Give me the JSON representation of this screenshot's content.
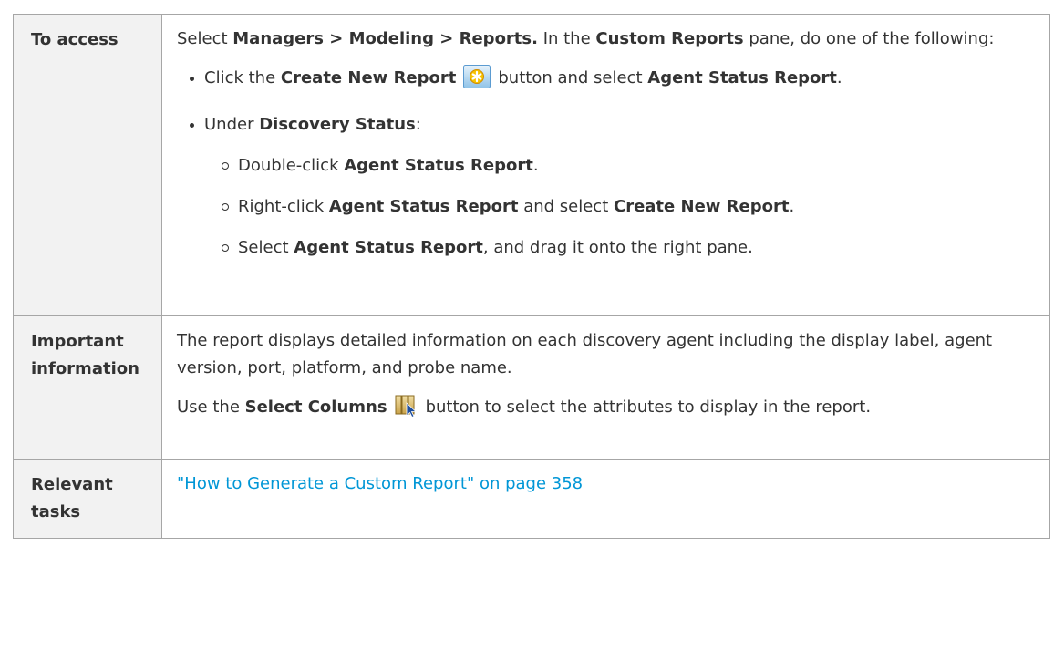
{
  "access": {
    "label": "To access",
    "intro": {
      "t1": "Select ",
      "b1": "Managers > Modeling > Reports.",
      "t2": " In the ",
      "b2": "Custom Reports",
      "t3": " pane, do one of the following:"
    },
    "bullet1": {
      "t1": "Click the ",
      "b1": "Create New Report",
      "icon": "create-new-report-icon",
      "t2": "button and select ",
      "b2": "Agent Status Report",
      "t3": "."
    },
    "bullet2": {
      "t1": "Under ",
      "b1": "Discovery Status",
      "t2": ":"
    },
    "sub1": {
      "t1": "Double-click ",
      "b1": "Agent Status Report",
      "t2": "."
    },
    "sub2": {
      "t1": "Right-click ",
      "b1": "Agent Status Report",
      "t2": " and select ",
      "b2": "Create New Report",
      "t3": "."
    },
    "sub3": {
      "t1": "Select ",
      "b1": "Agent Status Report",
      "t2": ", and drag it onto the right pane."
    }
  },
  "important": {
    "label": "Important information",
    "para1": "The report displays detailed information on each discovery agent including the display label, agent version, port, platform, and probe name.",
    "para2": {
      "t1": "Use the ",
      "b1": "Select Columns",
      "icon": "select-columns-icon",
      "t2": "button to select the attributes to display in the report."
    }
  },
  "tasks": {
    "label": "Relevant tasks",
    "link": "\"How to Generate a Custom Report\" on page 358"
  },
  "colors": {
    "link": "#0096d6",
    "label_bg": "#f2f2f2",
    "border": "#a6a6a6"
  }
}
